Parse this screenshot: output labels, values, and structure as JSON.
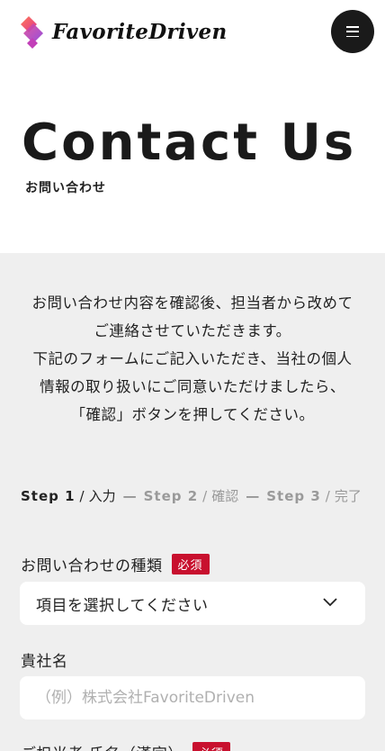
{
  "header": {
    "logo_text": "FavoriteDriven",
    "logo_icon": "brand-gem-icon",
    "menu_icon": "hamburger-icon"
  },
  "hero": {
    "title": "Contact Us",
    "subtitle": "お問い合わせ"
  },
  "intro": {
    "lines": [
      "お問い合わせ内容を確認後、担当者から改めて",
      "ご連絡させていただきます。",
      "下記のフォームにご記入いただき、当社の個人",
      "情報の取り扱いにご同意いただけましたら、",
      "「確認」ボタンを押してください。"
    ]
  },
  "steps": {
    "items": [
      {
        "num": "Step 1",
        "label": "入力",
        "state": "active"
      },
      {
        "num": "Step 2",
        "label": "確認",
        "state": "inactive"
      },
      {
        "num": "Step 3",
        "label": "完了",
        "state": "inactive"
      }
    ],
    "separator": "—",
    "slash": "/"
  },
  "form": {
    "inquiry_type": {
      "label": "お問い合わせの種類",
      "required": "必須",
      "selected": "項目を選択してください"
    },
    "company": {
      "label": "貴社名",
      "placeholder": "（例）株式会社FavoriteDriven"
    },
    "person_name": {
      "label": "ご担当者 氏名（漢字）",
      "required": "必須"
    }
  },
  "colors": {
    "required_badge": "#c8102e",
    "panel_bg": "#efefef",
    "menu_bg": "#1a1a1a"
  }
}
